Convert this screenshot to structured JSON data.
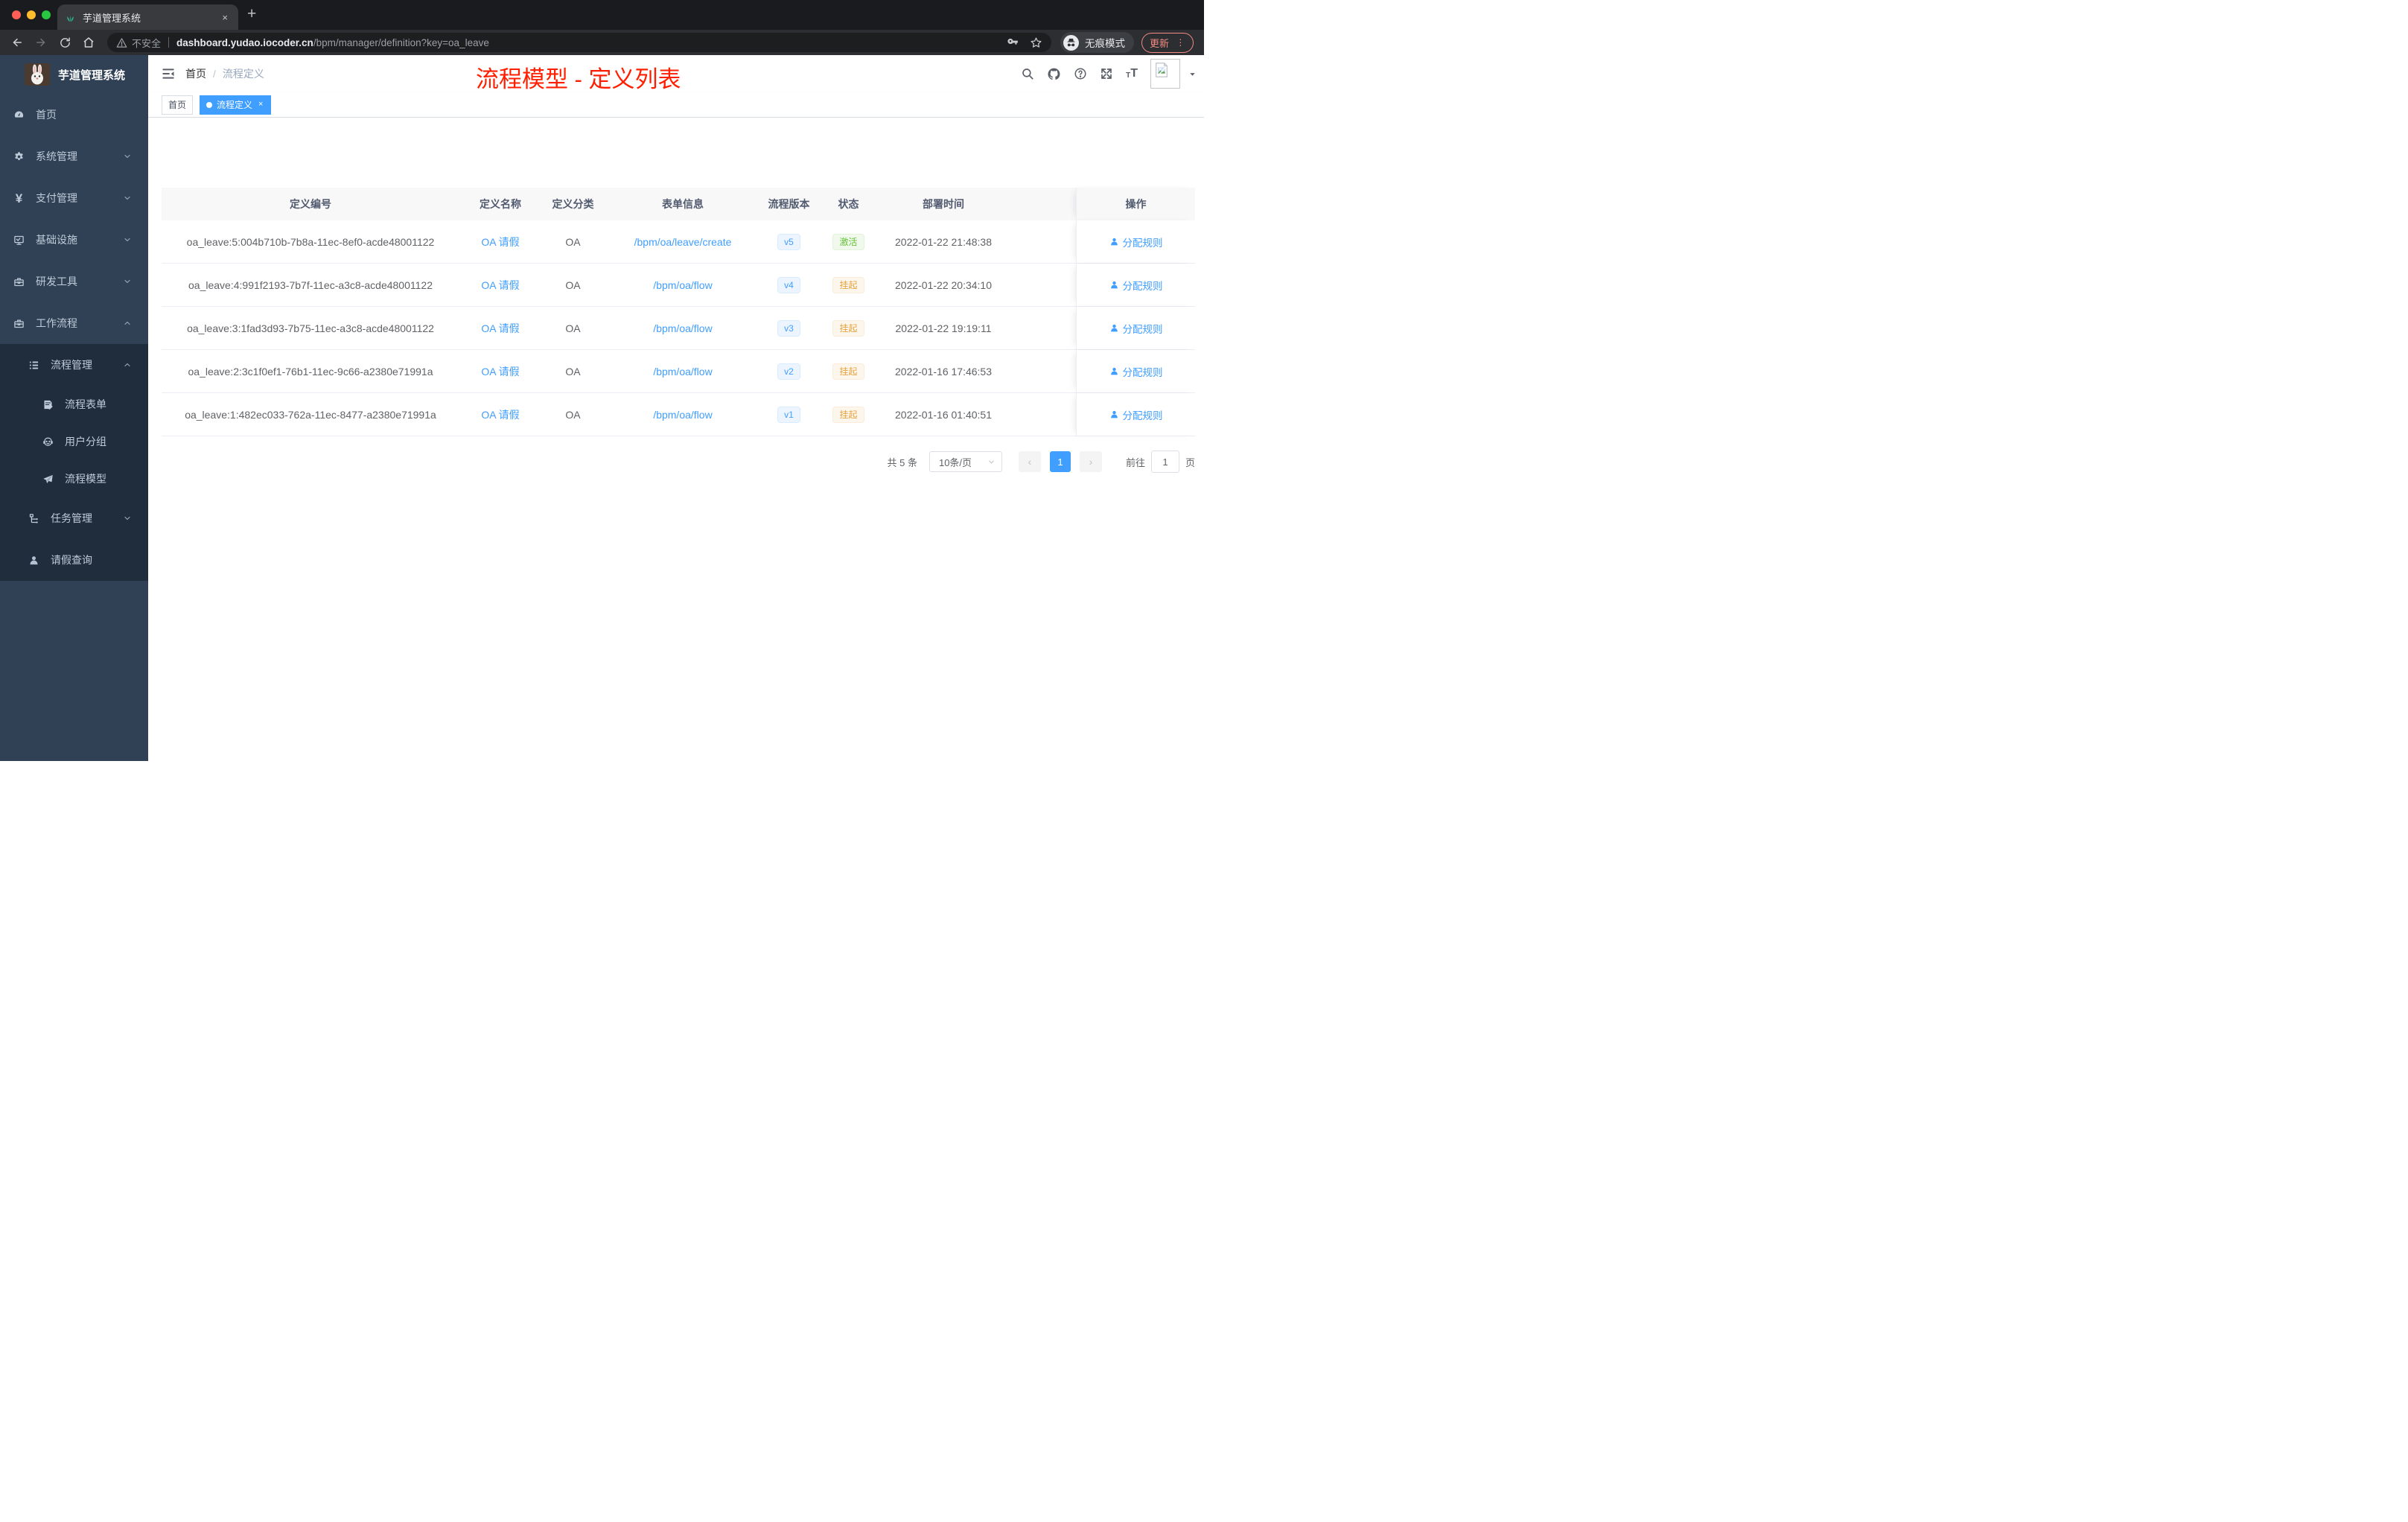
{
  "browser": {
    "tab": {
      "title": "芋道管理系统",
      "close": "×",
      "new_tab": "+"
    },
    "address": {
      "security_label": "不安全",
      "domain": "dashboard.yudao.iocoder.cn",
      "path": "/bpm/manager/definition?key=oa_leave"
    },
    "incognito_label": "无痕模式",
    "update_label": "更新",
    "kebab": "⋮"
  },
  "sidebar": {
    "app_title": "芋道管理系统",
    "items": [
      {
        "label": "首页"
      },
      {
        "label": "系统管理"
      },
      {
        "label": "支付管理"
      },
      {
        "label": "基础设施"
      },
      {
        "label": "研发工具"
      },
      {
        "label": "工作流程"
      }
    ],
    "workflow": {
      "process_mgmt": "流程管理",
      "children": [
        {
          "label": "流程表单"
        },
        {
          "label": "用户分组"
        },
        {
          "label": "流程模型"
        }
      ],
      "task_mgmt": "任务管理",
      "leave_query": "请假查询"
    },
    "yen_glyph": "¥"
  },
  "header": {
    "breadcrumb": {
      "home": "首页",
      "separator": "/",
      "current": "流程定义"
    },
    "annotation": "流程模型 - 定义列表",
    "font_small": "T",
    "font_big": "T"
  },
  "tags": [
    {
      "label": "首页"
    },
    {
      "label": "流程定义",
      "close": "×"
    }
  ],
  "table": {
    "columns": [
      "定义编号",
      "定义名称",
      "定义分类",
      "表单信息",
      "流程版本",
      "状态",
      "部署时间",
      "操作"
    ],
    "action_label": "分配规则",
    "rows": [
      {
        "id": "oa_leave:5:004b710b-7b8a-11ec-8ef0-acde48001122",
        "name": "OA 请假",
        "category": "OA",
        "form": "/bpm/oa/leave/create",
        "version": "v5",
        "status": "激活",
        "deployed_at": "2022-01-22 21:48:38"
      },
      {
        "id": "oa_leave:4:991f2193-7b7f-11ec-a3c8-acde48001122",
        "name": "OA 请假",
        "category": "OA",
        "form": "/bpm/oa/flow",
        "version": "v4",
        "status": "挂起",
        "deployed_at": "2022-01-22 20:34:10"
      },
      {
        "id": "oa_leave:3:1fad3d93-7b75-11ec-a3c8-acde48001122",
        "name": "OA 请假",
        "category": "OA",
        "form": "/bpm/oa/flow",
        "version": "v3",
        "status": "挂起",
        "deployed_at": "2022-01-22 19:19:11"
      },
      {
        "id": "oa_leave:2:3c1f0ef1-76b1-11ec-9c66-a2380e71991a",
        "name": "OA 请假",
        "category": "OA",
        "form": "/bpm/oa/flow",
        "version": "v2",
        "status": "挂起",
        "deployed_at": "2022-01-16 17:46:53"
      },
      {
        "id": "oa_leave:1:482ec033-762a-11ec-8477-a2380e71991a",
        "name": "OA 请假",
        "category": "OA",
        "form": "/bpm/oa/flow",
        "version": "v1",
        "status": "挂起",
        "deployed_at": "2022-01-16 01:40:51"
      }
    ]
  },
  "pagination": {
    "total": "共 5 条",
    "page_size": "10条/页",
    "prev": "‹",
    "page": "1",
    "next": "›",
    "goto_label": "前往",
    "goto_value": "1",
    "unit": "页"
  },
  "colors": {
    "accent": "#409eff",
    "annotation_red": "#ff1f00",
    "status_active": "#67c23a",
    "status_suspended": "#e6a23c",
    "sidebar_bg": "#304156",
    "submenu_bg": "#1f2d3d",
    "update_salmon": "#f28b82"
  }
}
